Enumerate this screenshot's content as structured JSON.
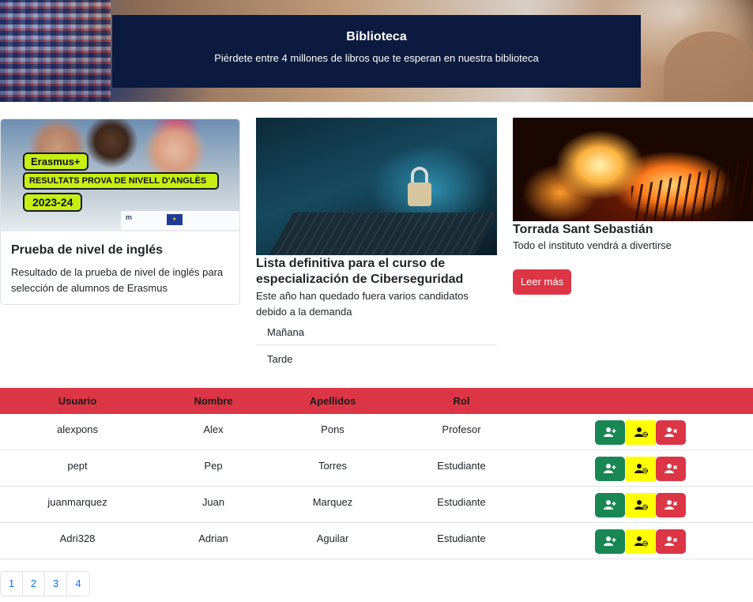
{
  "hero": {
    "title": "Biblioteca",
    "subtitle": "Piérdete entre 4 millones de libros que te esperan en nuestra biblioteca"
  },
  "cards": [
    {
      "image_text": {
        "tag": "Erasmus+",
        "banner": "RESULTATS PROVA DE NIVELL D'ANGLÈS",
        "year": "2023-24"
      },
      "title": "Prueba de nivel de inglés",
      "text": "Resultado de la prueba de nivel de inglés para selección de alumnos de Erasmus"
    },
    {
      "title": "Lista definitiva para el curso de especialización de Ciberseguridad",
      "text": "Este año han quedado fuera varios candidatos debido a la demanda",
      "list": [
        "Mañana",
        "Tarde"
      ]
    },
    {
      "title": "Torrada Sant Sebastián",
      "text": "Todo el instituto vendrá a divertirse",
      "button": "Leer más"
    }
  ],
  "table": {
    "headers": [
      "Usuario",
      "Nombre",
      "Apellidos",
      "Rol"
    ],
    "rows": [
      [
        "alexpons",
        "Alex",
        "Pons",
        "Profesor"
      ],
      [
        "pept",
        "Pep",
        "Torres",
        "Estudiante"
      ],
      [
        "juanmarquez",
        "Juan",
        "Marquez",
        "Estudiante"
      ],
      [
        "Adri328",
        "Adrian",
        "Aguilar",
        "Estudiante"
      ]
    ],
    "action_icons": [
      "person-plus-icon",
      "person-gear-icon",
      "person-x-icon"
    ],
    "colors": {
      "header": "#dc3545",
      "add": "#198754",
      "edit": "#ffff00",
      "delete": "#dc3545"
    }
  },
  "pagination": [
    "1",
    "2",
    "3",
    "4"
  ]
}
